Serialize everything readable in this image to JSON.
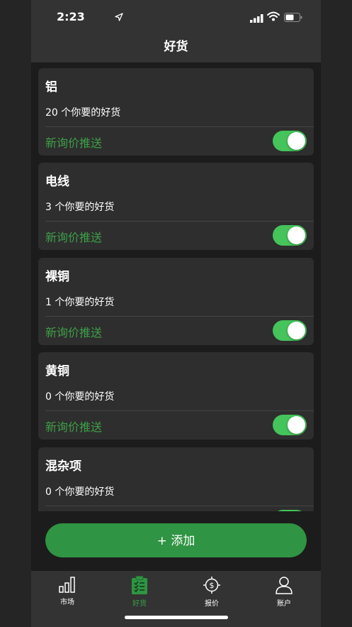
{
  "status_bar": {
    "time": "2:23"
  },
  "header": {
    "title": "好货"
  },
  "push_label": "新询价推送",
  "cards": [
    {
      "title": "铝",
      "count": "20 个你要的好货",
      "push_enabled": true
    },
    {
      "title": "电线",
      "count": "3 个你要的好货",
      "push_enabled": true
    },
    {
      "title": "裸铜",
      "count": "1 个你要的好货",
      "push_enabled": true
    },
    {
      "title": "黄铜",
      "count": "0 个你要的好货",
      "push_enabled": true
    },
    {
      "title": "混杂项",
      "count": "0 个你要的好货",
      "push_enabled": true
    }
  ],
  "add_button": {
    "label": "+ 添加"
  },
  "tabs": [
    {
      "label": "市场",
      "icon": "bar-chart-icon",
      "active": false
    },
    {
      "label": "好货",
      "icon": "clipboard-icon",
      "active": true
    },
    {
      "label": "报价",
      "icon": "dollar-target-icon",
      "active": false
    },
    {
      "label": "账户",
      "icon": "person-icon",
      "active": false
    }
  ],
  "colors": {
    "accent": "#2f9443",
    "toggle_on": "#44c45a",
    "push_label": "#3d9f47",
    "background": "#1c1c1c",
    "card": "#2e2e2e"
  }
}
